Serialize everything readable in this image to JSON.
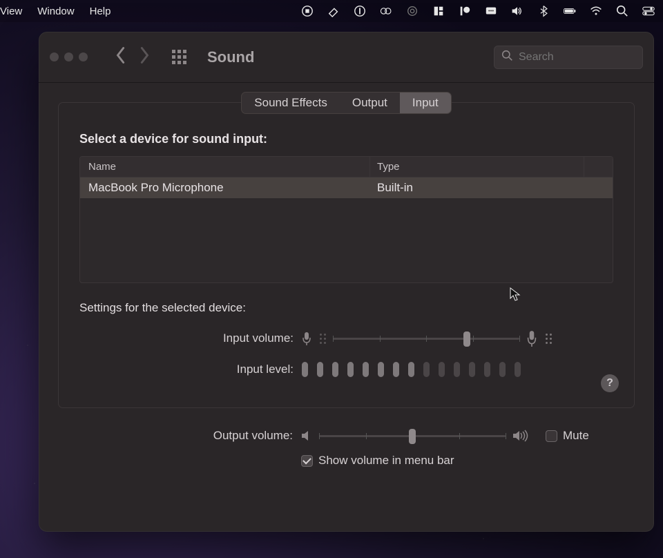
{
  "menubar": {
    "items": [
      "View",
      "Window",
      "Help"
    ]
  },
  "window": {
    "title": "Sound",
    "search_placeholder": "Search"
  },
  "tabs": {
    "items": [
      "Sound Effects",
      "Output",
      "Input"
    ],
    "active_index": 2
  },
  "input_section": {
    "heading": "Select a device for sound input:",
    "columns": {
      "name": "Name",
      "type": "Type"
    },
    "row": {
      "name": "MacBook Pro Microphone",
      "type": "Built-in"
    }
  },
  "settings": {
    "heading": "Settings for the selected device:",
    "input_volume_label": "Input volume:",
    "input_volume_percent": 72,
    "input_level_label": "Input level:",
    "input_level_active": 8,
    "input_level_total": 15
  },
  "footer": {
    "output_volume_label": "Output volume:",
    "output_volume_percent": 50,
    "mute_label": "Mute",
    "mute_checked": false,
    "show_in_menubar_label": "Show volume in menu bar",
    "show_in_menubar_checked": true
  },
  "help": "?"
}
